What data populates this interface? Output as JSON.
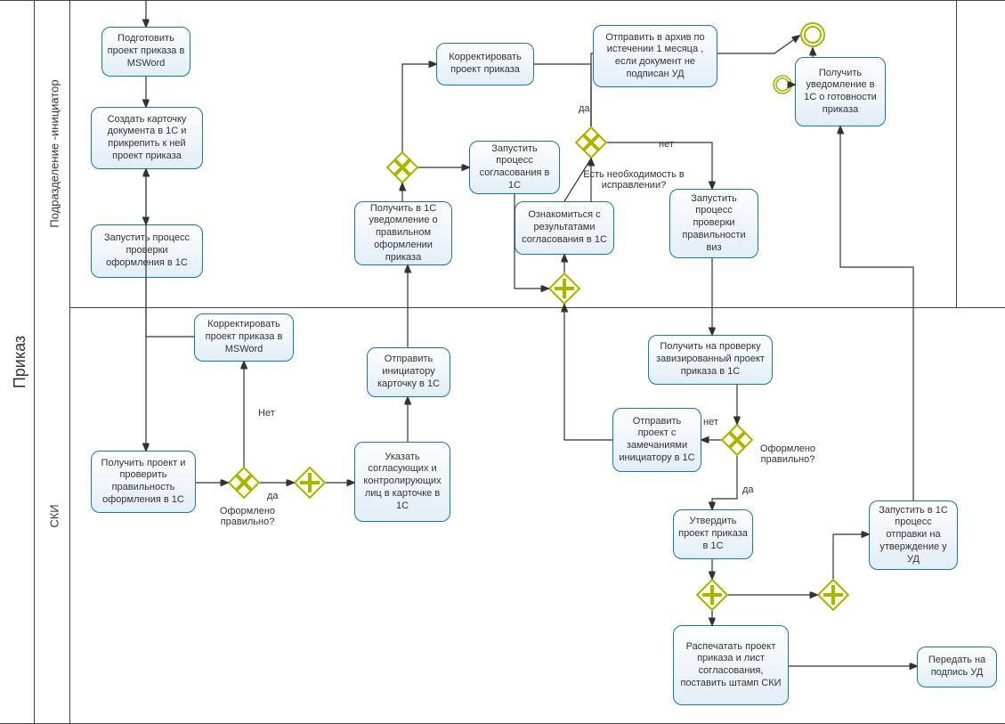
{
  "pool": {
    "label": "Приказ"
  },
  "lanes": {
    "top": {
      "label": "Подразделение -инициатор"
    },
    "bottom": {
      "label": "СКИ"
    }
  },
  "tasks": {
    "t1": "Подготовить проект приказа в MSWord",
    "t2": "Создать  карточку документа в 1С  и прикрепить к ней проект приказа",
    "t3": "Запустить процесс проверки оформления в 1С",
    "t4": "Получить проект и проверить правильность оформления в 1С",
    "t5": "Корректировать проект приказа в MSWord",
    "t6": "Указать согласующих и контролирующих лиц в карточке в 1С",
    "t7": "Отправить инициатору карточку в 1С",
    "t8": "Получить в 1С уведомление о правильном оформлении приказа",
    "t9": "Запустить процесс согласования в 1С",
    "t10": "Корректировать проект приказа",
    "t11": "Ознакомиться с результатами согласования в 1С",
    "t12": "Запустить процесс проверки правильности виз",
    "t13": "Получить на проверку завизированный проект приказа в 1С",
    "t14": "Отправить проект с замечаниями инициатору в 1С",
    "t15": "Утвердить проект приказа в 1С",
    "t16": "Распечатать проект приказа и лист согласования, поставить штамп СКИ",
    "t17": "Запустить в 1С процесс отправки на утверждение у УД",
    "t18": "Передать на подпись УД",
    "t19": "Отправить в архив по истечении 1 месяца , если документ не подписан УД",
    "t20": "Получить уведомление в 1С о готовности приказа"
  },
  "gatewayLabels": {
    "g1_q": "Оформлено правильно?",
    "g1_yes": "да",
    "g1_no": "Нет",
    "g3_q": "Есть необходимость в исправлении?",
    "g3_yes": "да",
    "g3_no": "нет",
    "g4_q": "Оформлено правильно?",
    "g4_yes": "да",
    "g4_no": "нет"
  }
}
